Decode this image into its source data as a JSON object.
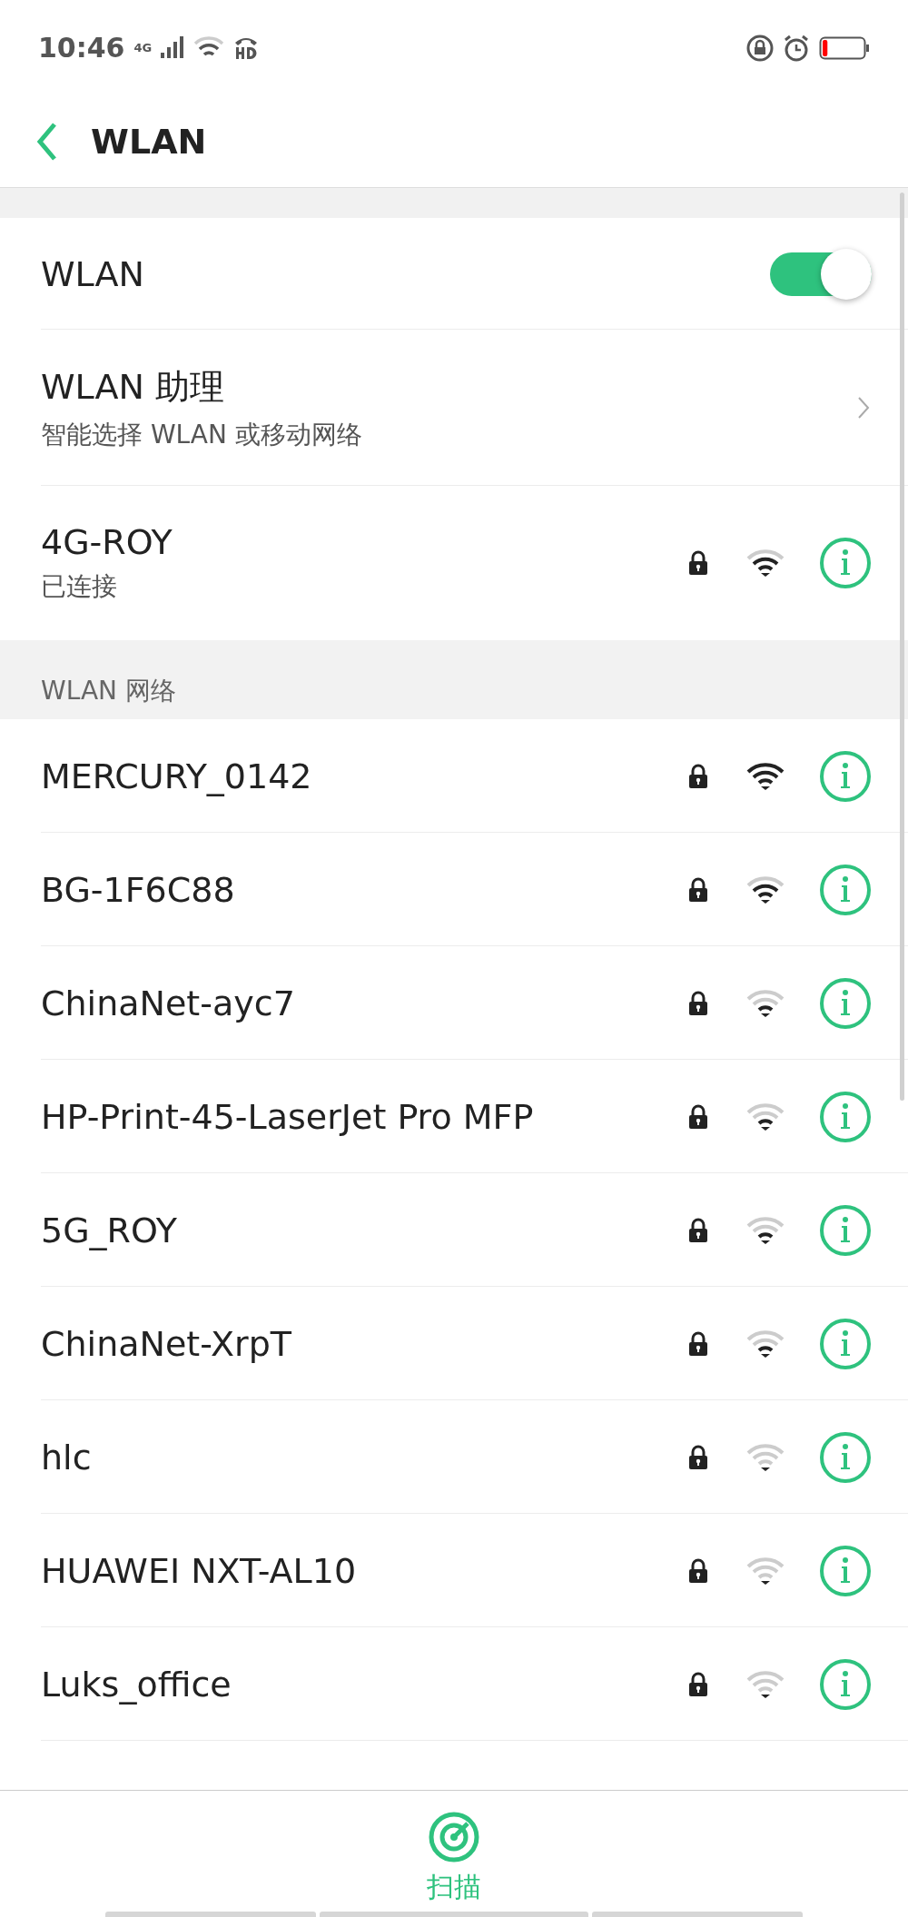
{
  "status_bar": {
    "time": "10:46",
    "network": "4G",
    "battery": {
      "level": 0.12
    }
  },
  "header": {
    "title": "WLAN"
  },
  "wlan_toggle": {
    "label": "WLAN",
    "on": true
  },
  "assistant": {
    "title": "WLAN 助理",
    "subtitle": "智能选择 WLAN 或移动网络"
  },
  "connected": {
    "name": "4G-ROY",
    "status": "已连接",
    "locked": true,
    "kind": "good"
  },
  "section_title": "WLAN 网络",
  "networks": [
    {
      "name": "MERCURY_0142",
      "locked": true,
      "kind": "strong"
    },
    {
      "name": "BG-1F6C88",
      "locked": true,
      "kind": "good"
    },
    {
      "name": "ChinaNet-ayc7",
      "locked": true,
      "kind": "fair"
    },
    {
      "name": "HP-Print-45-LaserJet Pro MFP",
      "locked": true,
      "kind": "fair"
    },
    {
      "name": "5G_ROY",
      "locked": true,
      "kind": "fair"
    },
    {
      "name": "ChinaNet-XrpT",
      "locked": true,
      "kind": "fair"
    },
    {
      "name": "hlc",
      "locked": true,
      "kind": "weak"
    },
    {
      "name": "HUAWEI NXT-AL10",
      "locked": true,
      "kind": "weak"
    },
    {
      "name": "Luks_office",
      "locked": true,
      "kind": "weak"
    }
  ],
  "bottom_bar": {
    "action": "扫描"
  }
}
